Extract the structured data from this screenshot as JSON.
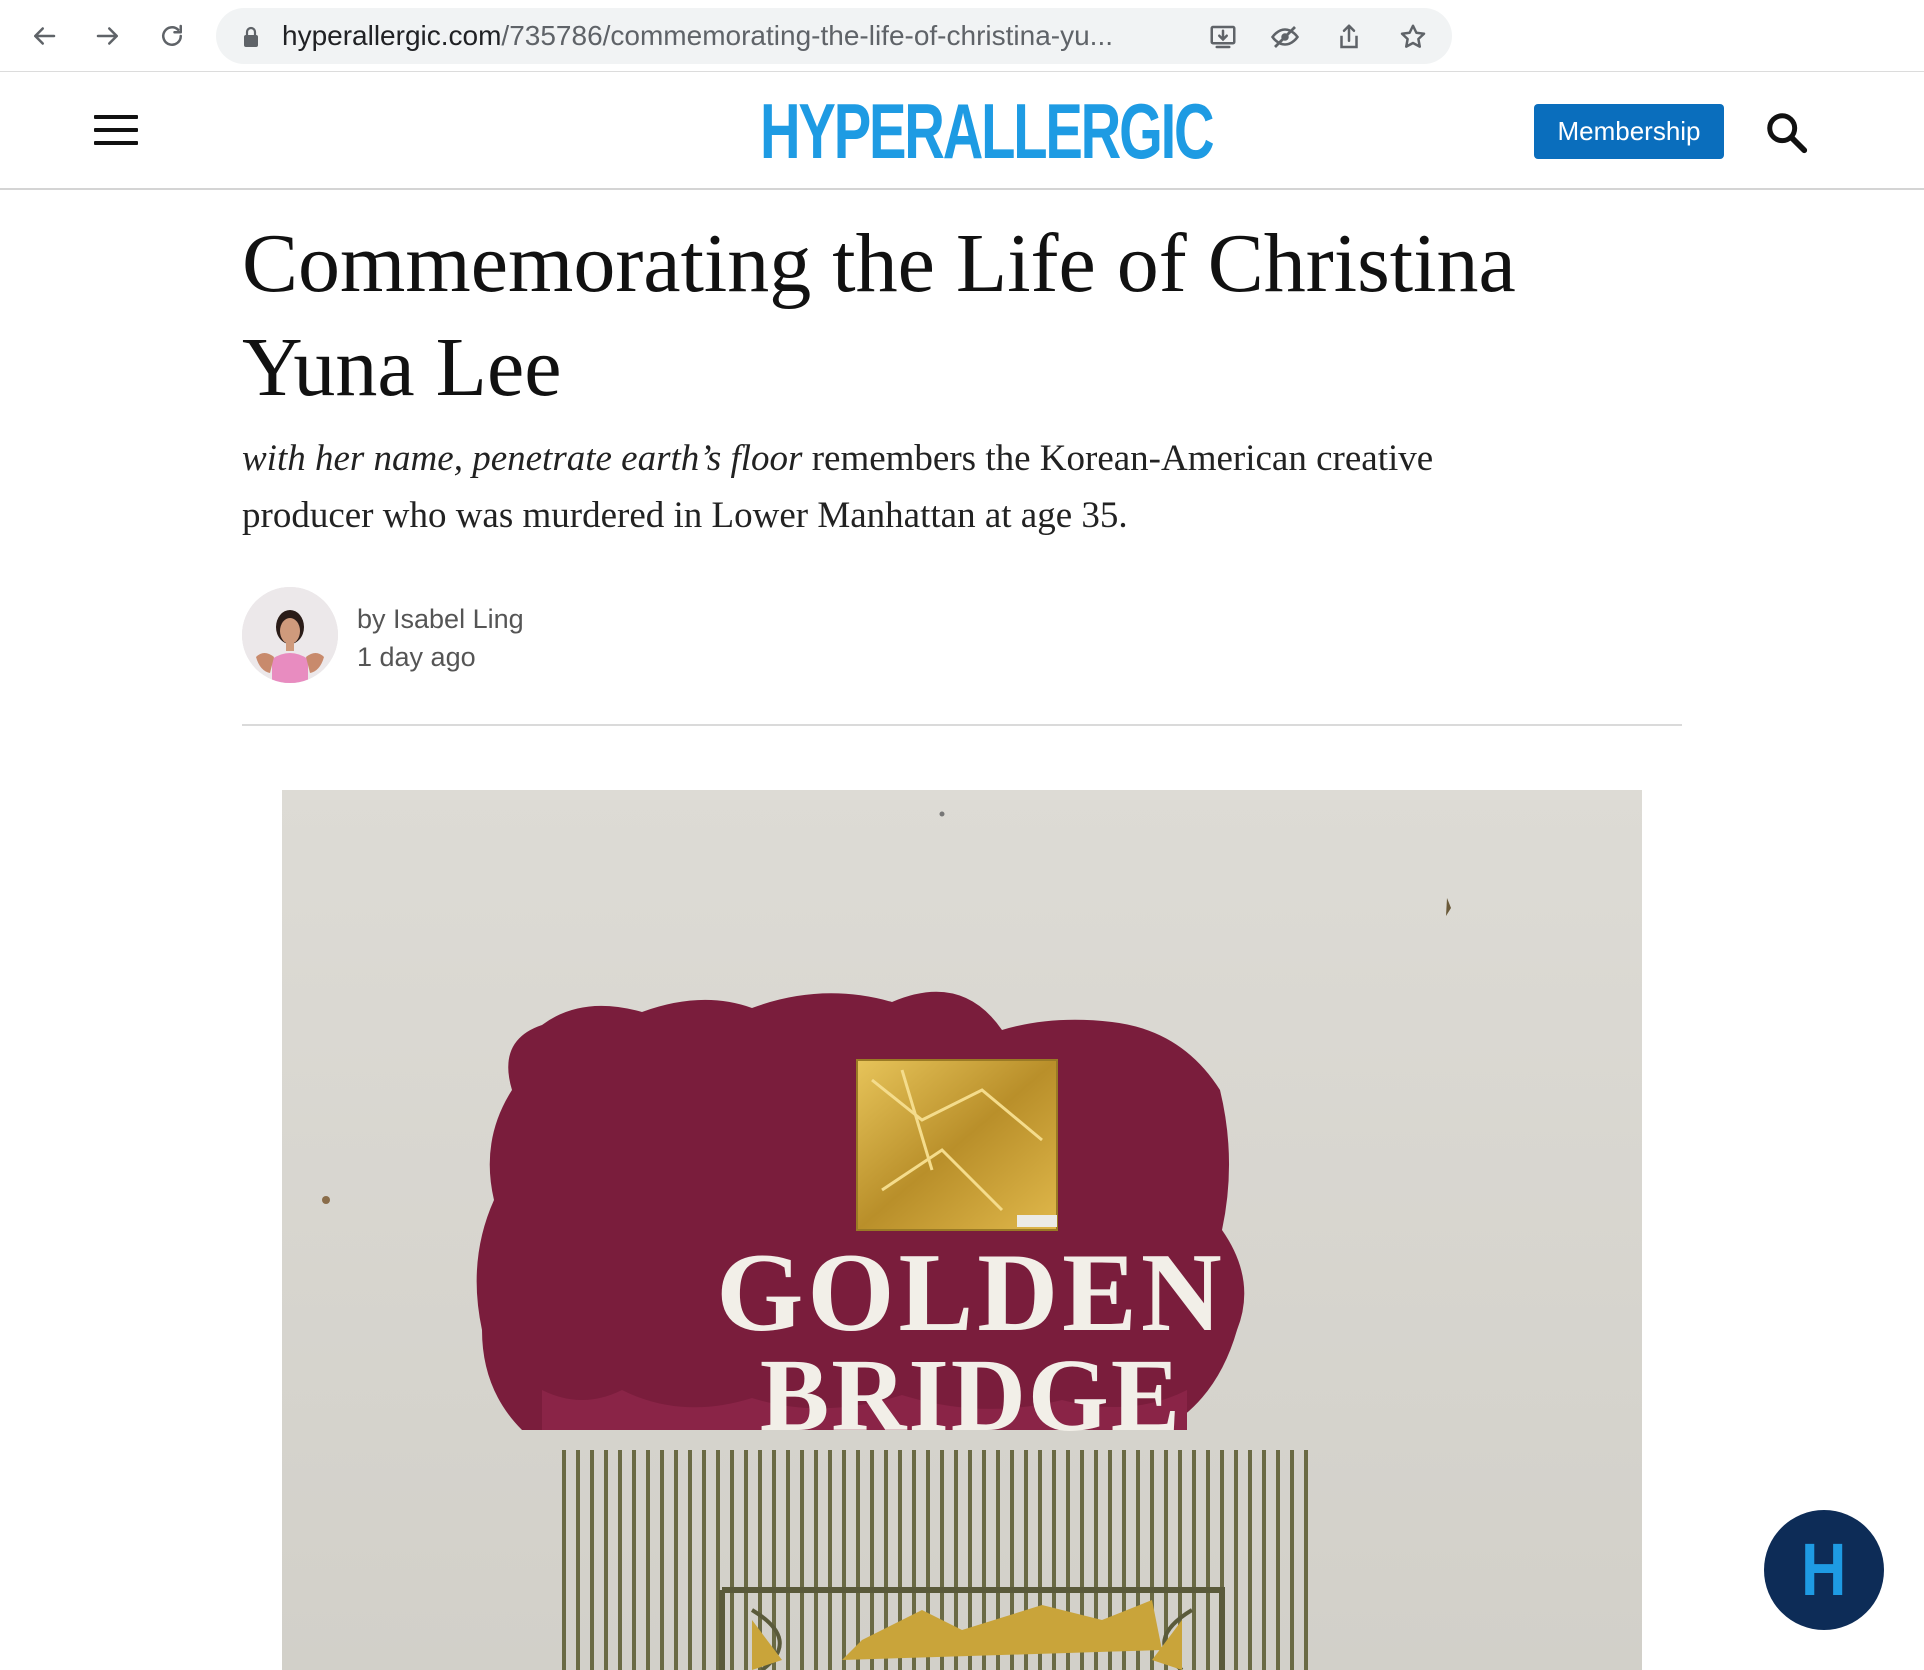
{
  "browser": {
    "url_host": "hyperallergic.com",
    "url_path": "/735786/commemorating-the-life-of-christina-yu..."
  },
  "site": {
    "logo": "HYPERALLERGIC",
    "membership_label": "Membership",
    "float_button_label": "H"
  },
  "article": {
    "title": "Commemorating the Life of Christina Yuna Lee",
    "dek_italic": "with her name, penetrate earth’s floor",
    "dek_rest": " remembers the Korean-American creative producer who was murdered in Lower Manhattan at age 35.",
    "byline": "by Isabel Ling",
    "date": "1 day ago"
  },
  "hero_image": {
    "line1": "GOLDEN",
    "line2": "BRIDGE"
  },
  "colors": {
    "brand_blue": "#1e9be3",
    "membership_bg": "#0a6ebd",
    "float_bg": "#0d2c57",
    "paint_crimson": "#7a1d3c",
    "gold": "#c9a43a"
  }
}
